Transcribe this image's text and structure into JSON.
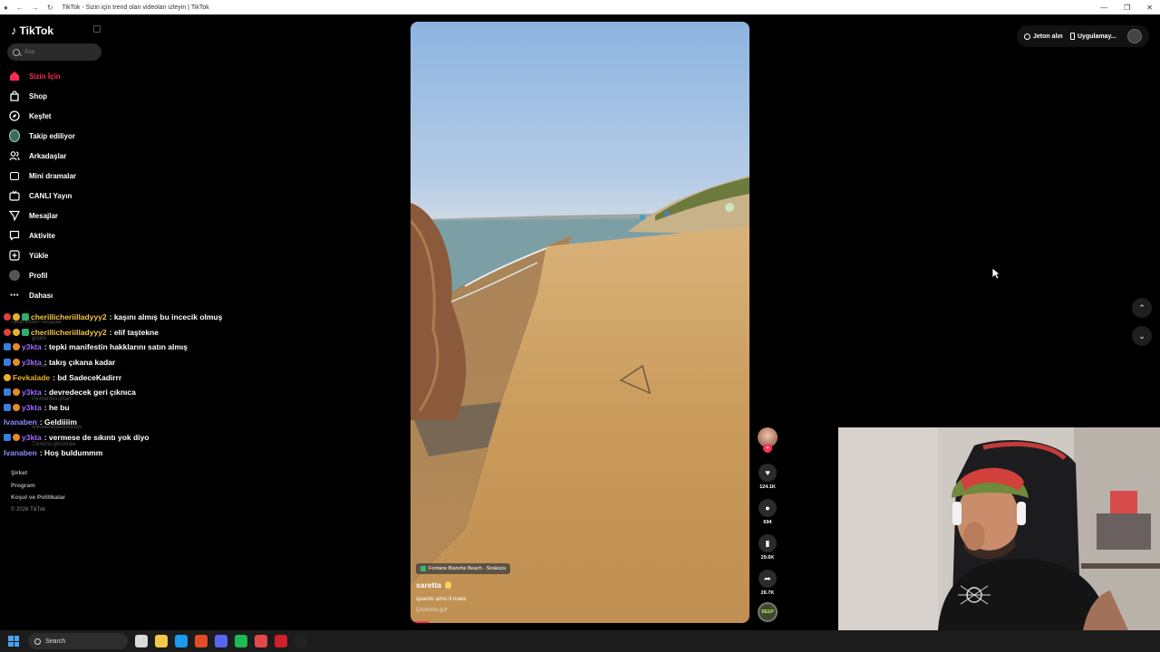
{
  "browser": {
    "tab_title": "TikTok - Sizin için trend olan videoları izleyin | TikTok",
    "window_controls": [
      "—",
      "❐",
      "✕"
    ]
  },
  "sidebar": {
    "logo": "TikTok",
    "search_placeholder": "Ara",
    "items": [
      {
        "label": "Sizin İçin",
        "icon": "home-icon"
      },
      {
        "label": "Shop",
        "icon": "shop-bag-icon"
      },
      {
        "label": "Keşfet",
        "icon": "compass-icon"
      },
      {
        "label": "Takip ediliyor",
        "icon": "following-avatar-icon"
      },
      {
        "label": "Arkadaşlar",
        "icon": "friends-icon"
      },
      {
        "label": "Mini dramalar",
        "icon": "mini-drama-icon"
      },
      {
        "label": "CANLI Yayın",
        "icon": "live-icon"
      },
      {
        "label": "Mesajlar",
        "icon": "messages-icon"
      },
      {
        "label": "Aktivite",
        "icon": "activity-icon"
      },
      {
        "label": "Yükle",
        "icon": "upload-icon"
      },
      {
        "label": "Profil",
        "icon": "profile-avatar-icon"
      },
      {
        "label": "Dahası",
        "icon": "more-dots-icon"
      }
    ],
    "following_header": "Takip edilen hesaplar",
    "following": [
      "goddx",
      "Kenan",
      "Pelmentos-chan",
      "willowwwwwwwwww",
      "Tümünü görüntüle"
    ],
    "footer": [
      "Şirket",
      "Program",
      "Koşul ve Politikalar"
    ],
    "copyright": "© 2026 TikTok"
  },
  "chat": [
    {
      "user": "cherillicheriilladyyy2",
      "message": ": kaşını almış bu incecik olmuş",
      "user_color": "#f4c542",
      "badges": [
        "b-red",
        "b-gold",
        "b-green"
      ]
    },
    {
      "user": "cherillicheriilladyyy2",
      "message": ": elif taştekne",
      "user_color": "#f4c542",
      "badges": [
        "b-red",
        "b-gold",
        "b-green"
      ]
    },
    {
      "user": "y3kta",
      "message": ": tepki manifestin hakklarını satın almış",
      "user_color": "#9d6cff",
      "badges": [
        "b-blue",
        "b-orange"
      ]
    },
    {
      "user": "y3kta",
      "message": ": takış çıkana kadar",
      "user_color": "#9d6cff",
      "badges": [
        "b-blue",
        "b-orange"
      ]
    },
    {
      "user": "Fevkalade",
      "message": ": bd SadeceKadirrr",
      "user_color": "#e8b02a",
      "badges": [
        "b-gold"
      ]
    },
    {
      "user": "y3kta",
      "message": ": devredecek geri çıknıca",
      "user_color": "#9d6cff",
      "badges": [
        "b-blue",
        "b-orange"
      ]
    },
    {
      "user": "y3kta",
      "message": ": he bu",
      "user_color": "#9d6cff",
      "badges": [
        "b-blue",
        "b-orange"
      ]
    },
    {
      "user": "Ivanaben",
      "message": ": Geldiiiim",
      "user_color": "#8f8cff",
      "badges": []
    },
    {
      "user": "y3kta",
      "message": ": vermese de sıkıntı yok diyo",
      "user_color": "#9d6cff",
      "badges": [
        "b-blue",
        "b-orange"
      ]
    },
    {
      "user": "Ivanaben",
      "message": ": Hoş buldummm",
      "user_color": "#8f8cff",
      "badges": []
    }
  ],
  "video": {
    "location": "Fontane Bianche Beach - Siraküza",
    "author": "saretta",
    "caption": "quanto amo il mare",
    "translate": "Çevirisini gör",
    "likes": "124.1K",
    "comments": "694",
    "saves": "29.6K",
    "shares": "26.7K",
    "sound_disc_text": "BEEP"
  },
  "top_right": {
    "coins": "Jeton alın",
    "app": "Uygulamay..."
  },
  "taskbar": {
    "search": "Search",
    "apps": [
      "#d9d9d9",
      "#f2c94c",
      "#1b9bf0",
      "#e34c26",
      "#5865f2",
      "#1db954",
      "#e24a4a",
      "#d0202b",
      "#222222"
    ]
  }
}
